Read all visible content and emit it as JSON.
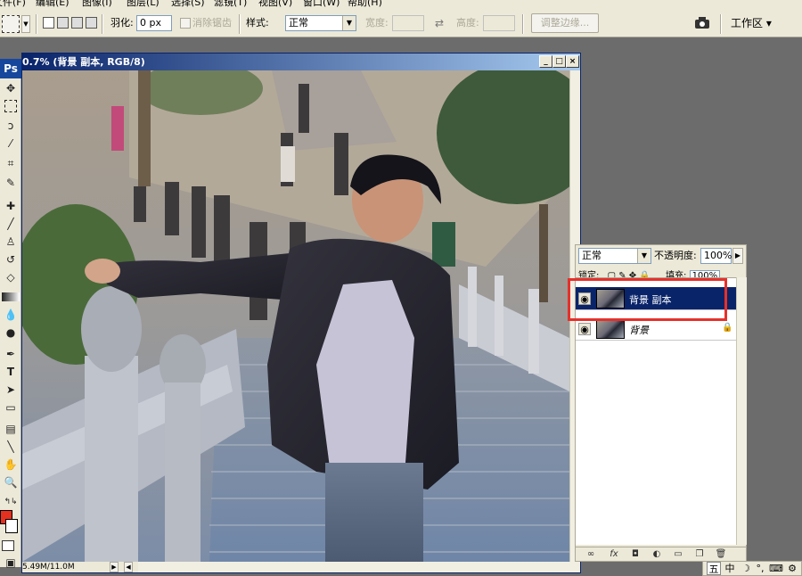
{
  "menubar": {
    "items": [
      "文件(F)",
      "编辑(E)",
      "图像(I)",
      "图层(L)",
      "选择(S)",
      "滤镜(T)",
      "视图(V)",
      "窗口(W)",
      "帮助(H)"
    ]
  },
  "options": {
    "feather_label": "羽化:",
    "feather_value": "0 px",
    "antialias_label": "消除锯齿",
    "style_label": "样式:",
    "style_value": "正常",
    "width_label": "宽度:",
    "height_label": "高度:",
    "refine_edge_label": "调整边缘...",
    "workspace_label": "工作区 ▾"
  },
  "document": {
    "title": "0.7% (背景 副本, RGB/8)",
    "status": "5.49M/11.0M"
  },
  "layers": {
    "blend_mode": "正常",
    "opacity_label": "不透明度:",
    "opacity_value": "100%",
    "lock_label": "锁定:",
    "fill_label": "填充:",
    "fill_value": "100%",
    "items": [
      {
        "name": "背景 副本",
        "visible": true,
        "active": true
      },
      {
        "name": "背景",
        "visible": true,
        "active": false,
        "locked": true
      }
    ]
  },
  "ime": {
    "items": [
      "五",
      "中",
      "☽",
      "°,",
      "⌨",
      "⚙"
    ]
  },
  "colors": {
    "foreground": "#e3301f",
    "background": "#ffffff",
    "highlight": "#e6302b",
    "title_active": "#0a246a"
  }
}
